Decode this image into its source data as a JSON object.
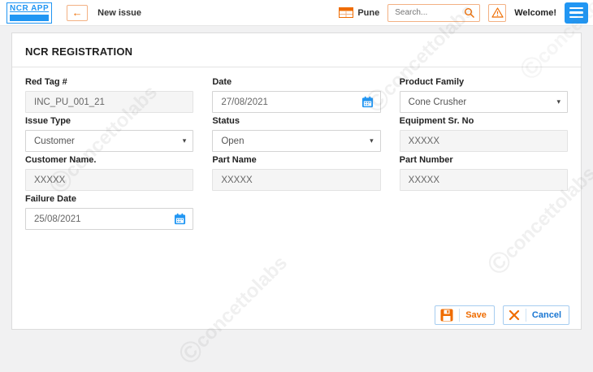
{
  "topbar": {
    "logo_text": "NCR APP",
    "back_arrow": "←",
    "new_issue_label": "New issue",
    "plant": "Pune",
    "search_placeholder": "Search...",
    "welcome_label": "Welcome!"
  },
  "form": {
    "title": "NCR REGISTRATION",
    "red_tag": {
      "label": "Red Tag #",
      "value": "INC_PU_001_21"
    },
    "date": {
      "label": "Date",
      "value": "27/08/2021"
    },
    "product_family": {
      "label": "Product Family",
      "value": "Cone Crusher"
    },
    "issue_type": {
      "label": "Issue Type",
      "value": "Customer"
    },
    "status": {
      "label": "Status",
      "value": "Open"
    },
    "equipment_sr_no": {
      "label": "Equipment Sr. No",
      "value": "XXXXX"
    },
    "customer_name": {
      "label": "Customer Name.",
      "value": "XXXXX"
    },
    "part_name": {
      "label": "Part Name",
      "value": "XXXXX"
    },
    "part_number": {
      "label": "Part Number",
      "value": "XXXXX"
    },
    "failure_date": {
      "label": "Failure Date",
      "value": "25/08/2021"
    },
    "caret": "▾"
  },
  "buttons": {
    "save": "Save",
    "cancel": "Cancel"
  },
  "watermark": {
    "symbol": "©",
    "text": "concettolabs"
  },
  "colors": {
    "accent_blue": "#2196f3",
    "accent_orange": "#ef6c00",
    "cancel_blue": "#1976d2"
  }
}
